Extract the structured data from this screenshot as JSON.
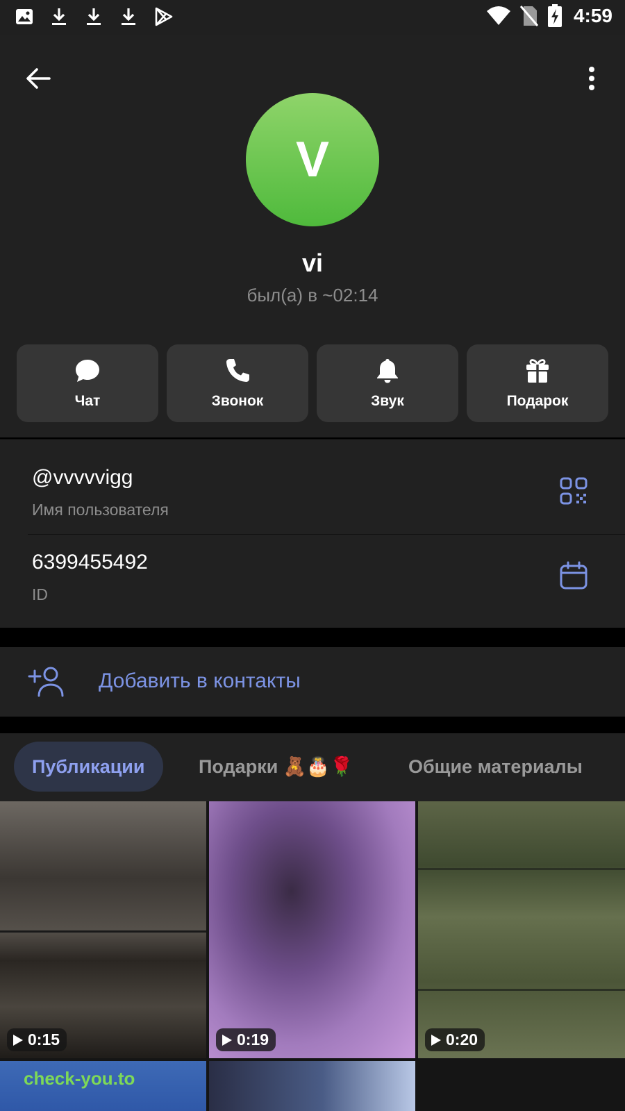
{
  "status_bar": {
    "time": "4:59",
    "left_icons": [
      "image-icon",
      "download-icon",
      "download-icon",
      "download-icon",
      "play-store-icon"
    ],
    "right_icons": [
      "wifi-icon",
      "no-sim-icon",
      "battery-charging-icon"
    ]
  },
  "header": {
    "avatar_letter": "V",
    "avatar_color": "#5cc045",
    "name": "vi",
    "status": "был(а) в ~02:14"
  },
  "actions": [
    {
      "label": "Чат",
      "icon": "chat-icon"
    },
    {
      "label": "Звонок",
      "icon": "phone-icon"
    },
    {
      "label": "Звук",
      "icon": "bell-icon"
    },
    {
      "label": "Подарок",
      "icon": "gift-icon"
    }
  ],
  "info": {
    "username": {
      "value": "@vvvvvigg",
      "label": "Имя пользователя",
      "icon": "qr-code-icon"
    },
    "id": {
      "value": "6399455492",
      "label": "ID",
      "icon": "calendar-icon"
    }
  },
  "add_contact": {
    "label": "Добавить в контакты",
    "icon": "add-user-icon"
  },
  "tabs": [
    {
      "label": "Публикации",
      "active": true
    },
    {
      "label": "Подарки 🧸🎂🌹",
      "active": false
    },
    {
      "label": "Общие материалы",
      "active": false
    }
  ],
  "media": [
    {
      "duration": "0:15"
    },
    {
      "duration": "0:19"
    },
    {
      "duration": "0:20"
    },
    {
      "watermark": "check-you.to"
    },
    {}
  ],
  "colors": {
    "accent": "#7c93e4",
    "background": "#212121",
    "button": "#363636"
  }
}
